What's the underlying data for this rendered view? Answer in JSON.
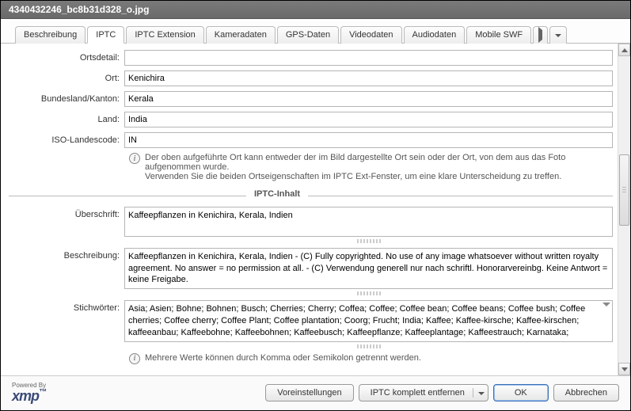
{
  "title": "4340432246_bc8b31d328_o.jpg",
  "tabs": [
    "Beschreibung",
    "IPTC",
    "IPTC Extension",
    "Kameradaten",
    "GPS-Daten",
    "Videodaten",
    "Audiodaten",
    "Mobile SWF"
  ],
  "activeTab": 1,
  "labels": {
    "ortsdetail": "Ortsdetail:",
    "ort": "Ort:",
    "bundesland": "Bundesland/Kanton:",
    "land": "Land:",
    "iso": "ISO-Landescode:",
    "ueberschrift": "Überschrift:",
    "beschreibung": "Beschreibung:",
    "stichwoerter": "Stichwörter:"
  },
  "values": {
    "ortsdetail": "",
    "ort": "Kenichira",
    "bundesland": "Kerala",
    "land": "India",
    "iso": "IN",
    "ueberschrift": "Kaffeepflanzen in Kenichira, Kerala, Indien",
    "beschreibung": "Kaffeepflanzen in Kenichira, Kerala, Indien - (C) Fully copyrighted. No use of any image whatsoever without written royalty agreement. No answer = no permission at all. - (C) Verwendung generell nur nach schriftl. Honorarvereinbg. Keine Antwort = keine Freigabe.",
    "stichwoerter": "Asia; Asien; Bohne; Bohnen; Busch; Cherries; Cherry; Coffea; Coffee; Coffee bean; Coffee beans; Coffee bush; Coffee cherries; Coffee cherry; Coffee Plant; Coffee plantation; Coorg; Frucht; India; Kaffee; Kaffee-kirsche; Kaffee-kirschen; kaffeeanbau; Kaffeebohne; Kaffeebohnen; Kaffeebusch; Kaffeepflanze; Kaffeeplantage; Kaffeestrauch; Karnataka;"
  },
  "info1a": "Der oben aufgeführte Ort kann entweder der im Bild dargestellte Ort sein oder der Ort, von dem aus das Foto aufgenommen wurde.",
  "info1b": "Verwenden Sie die beiden Ortseigenschaften im IPTC Ext-Fenster, um eine klare Unterscheidung zu treffen.",
  "section_iptc_inhalt": "IPTC-Inhalt",
  "info2": "Mehrere Werte können durch Komma oder Semikolon getrennt werden.",
  "logo": {
    "powered": "Powered By",
    "brand": "xmp"
  },
  "buttons": {
    "voreinstellungen": "Voreinstellungen",
    "iptc_entfernen": "IPTC komplett entfernen",
    "ok": "OK",
    "abbrechen": "Abbrechen"
  }
}
